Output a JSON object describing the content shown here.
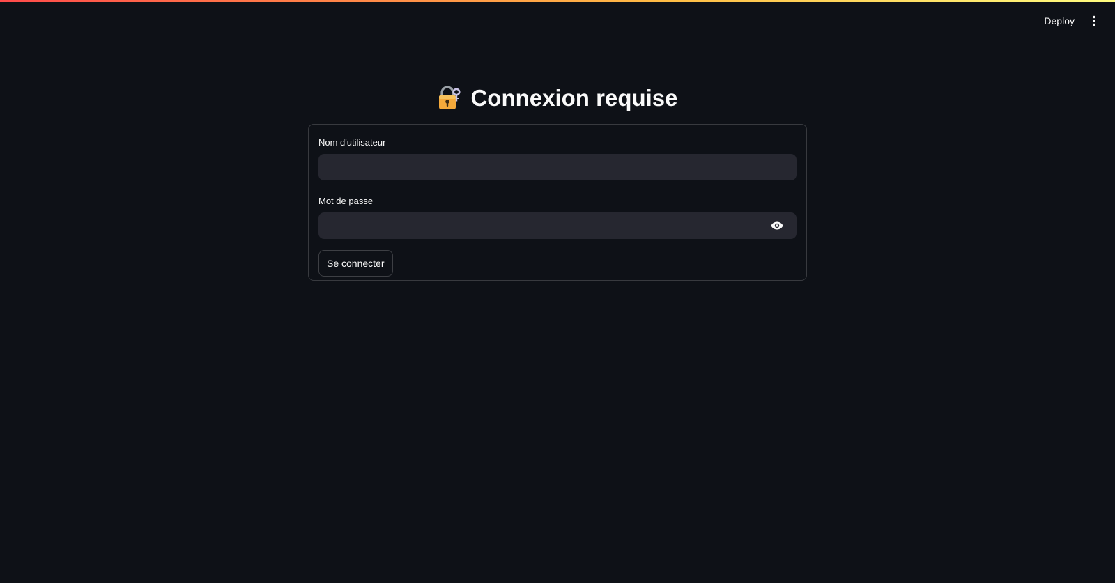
{
  "header": {
    "deploy_label": "Deploy",
    "menu_icon": "vertical-dots-icon"
  },
  "login": {
    "title_icon": "lock-with-key-icon",
    "title": "Connexion requise",
    "username": {
      "label": "Nom d'utilisateur",
      "value": "",
      "placeholder": ""
    },
    "password": {
      "label": "Mot de passe",
      "value": "",
      "placeholder": "",
      "toggle_icon": "eye-icon"
    },
    "submit_label": "Se connecter"
  },
  "colors": {
    "background": "#0e1117",
    "input_background": "#262730",
    "text": "#fafafa",
    "decoration_start": "#ff4b4b",
    "decoration_end": "#fffd80"
  }
}
